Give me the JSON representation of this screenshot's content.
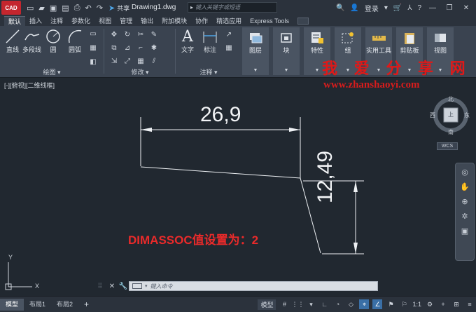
{
  "titlebar": {
    "logo": "CAD",
    "share": "共享",
    "document": "Drawing1.dwg",
    "search_placeholder": "键入关键字或短语",
    "login": "登录"
  },
  "tabs": [
    "默认",
    "插入",
    "注释",
    "参数化",
    "视图",
    "管理",
    "输出",
    "附加模块",
    "协作",
    "精选应用",
    "Express Tools"
  ],
  "ribbon": {
    "draw_tools": [
      "直线",
      "多段线",
      "圆",
      "圆弧"
    ],
    "draw_panel": "绘图",
    "modify_panel": "修改",
    "text_tool": "文字",
    "dim_tool": "标注",
    "annotate_panel": "注释",
    "layers": "图层",
    "block": "块",
    "properties": "特性",
    "group": "组",
    "utilities": "实用工具",
    "clipboard": "剪贴板",
    "view": "视图"
  },
  "drawing": {
    "view_label": "[-][俯视][二维线框]",
    "watermark_cn": "我 爱 分 享 网",
    "watermark_url": "www.zhanshaoyi.com",
    "dim_horizontal": "26,9",
    "dim_vertical": "12,49",
    "note": "DIMASSOC值设置为：2",
    "viewcube": {
      "north": "北",
      "south": "南",
      "east": "东",
      "west": "西",
      "face": "上",
      "wcs": "WCS"
    },
    "ucs_x": "X",
    "ucs_y": "Y"
  },
  "command": {
    "placeholder": "键入命令"
  },
  "statusbar": {
    "layouts": [
      "模型",
      "布局1",
      "布局2"
    ],
    "add": "+",
    "model": "模型",
    "scale": "1:1"
  }
}
